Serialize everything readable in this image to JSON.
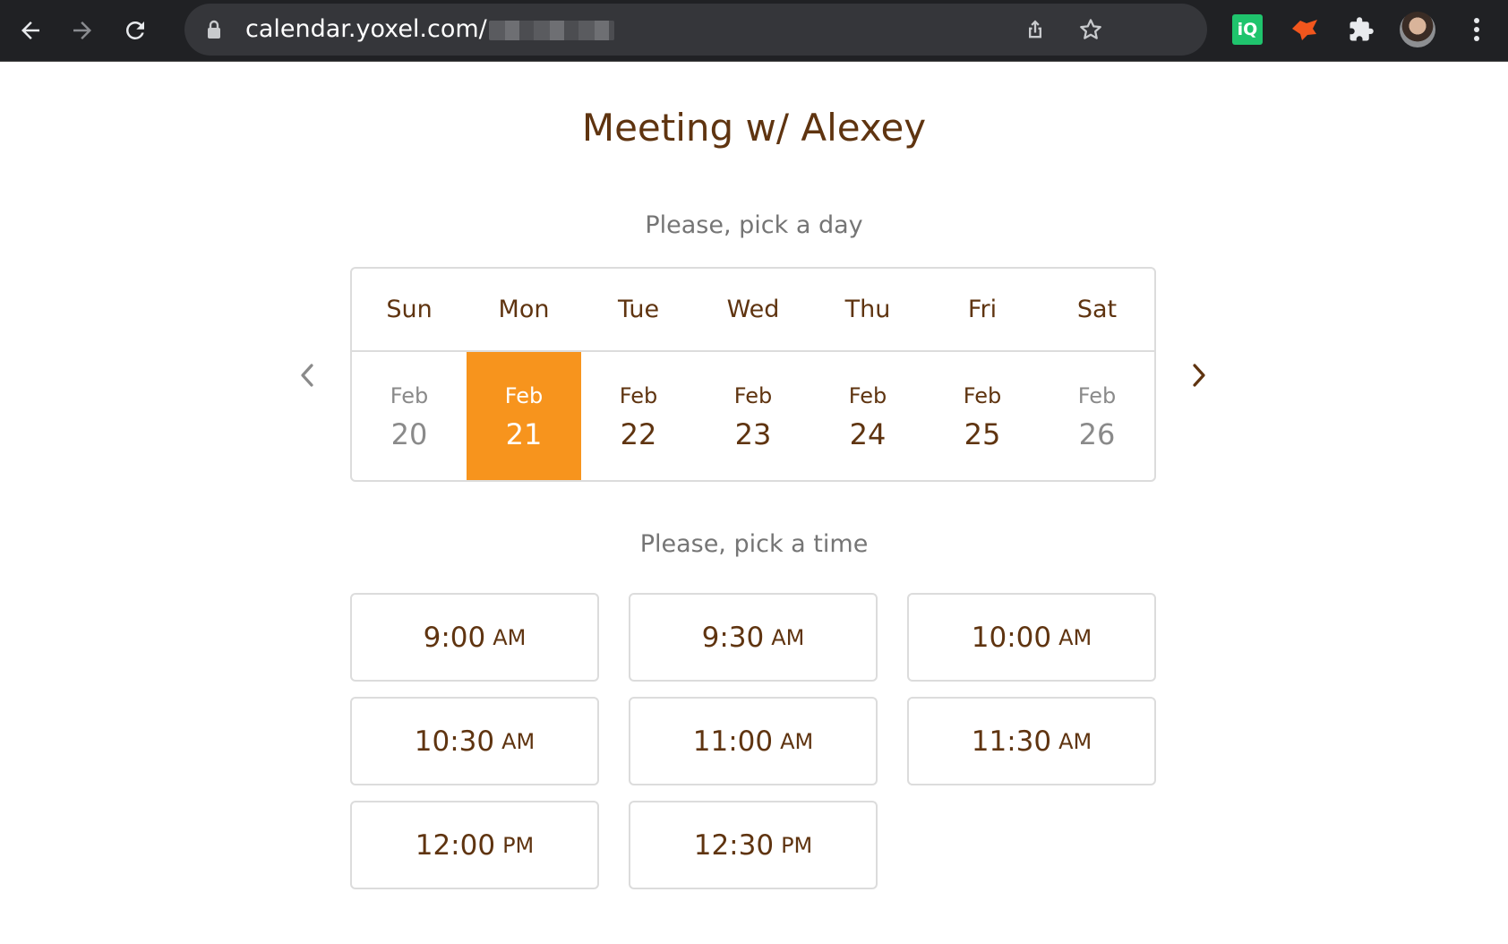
{
  "browser": {
    "url": "calendar.yoxel.com/",
    "icons": [
      "back-arrow-icon",
      "forward-arrow-icon",
      "reload-icon",
      "lock-icon",
      "share-icon",
      "star-icon",
      "puzzle-icon",
      "kebab-menu-icon"
    ],
    "extensions": [
      {
        "name": "iq-extension-icon",
        "label": "iQ",
        "color": "#1fc46d"
      },
      {
        "name": "fox-extension-icon",
        "color": "#f2561d"
      }
    ]
  },
  "page": {
    "title": "Meeting w/ Alexey",
    "pick_day_label": "Please, pick a day",
    "pick_time_label": "Please, pick a time"
  },
  "calendar": {
    "weekdays": [
      "Sun",
      "Mon",
      "Tue",
      "Wed",
      "Thu",
      "Fri",
      "Sat"
    ],
    "days": [
      {
        "month": "Feb",
        "day": "20",
        "state": "disabled"
      },
      {
        "month": "Feb",
        "day": "21",
        "state": "selected"
      },
      {
        "month": "Feb",
        "day": "22",
        "state": "available"
      },
      {
        "month": "Feb",
        "day": "23",
        "state": "available"
      },
      {
        "month": "Feb",
        "day": "24",
        "state": "available"
      },
      {
        "month": "Feb",
        "day": "25",
        "state": "available"
      },
      {
        "month": "Feb",
        "day": "26",
        "state": "disabled"
      }
    ],
    "prev_icon": "chevron-left-icon",
    "next_icon": "chevron-right-icon"
  },
  "time_slots": [
    {
      "time": "9:00",
      "period": "AM"
    },
    {
      "time": "9:30",
      "period": "AM"
    },
    {
      "time": "10:00",
      "period": "AM"
    },
    {
      "time": "10:30",
      "period": "AM"
    },
    {
      "time": "11:00",
      "period": "AM"
    },
    {
      "time": "11:30",
      "period": "AM"
    },
    {
      "time": "12:00",
      "period": "PM"
    },
    {
      "time": "12:30",
      "period": "PM"
    }
  ],
  "colors": {
    "accent": "#f7941d",
    "text_brown": "#5f3410",
    "muted_text": "#757575",
    "border": "#dcdcdc",
    "chrome_bg": "#202124"
  }
}
